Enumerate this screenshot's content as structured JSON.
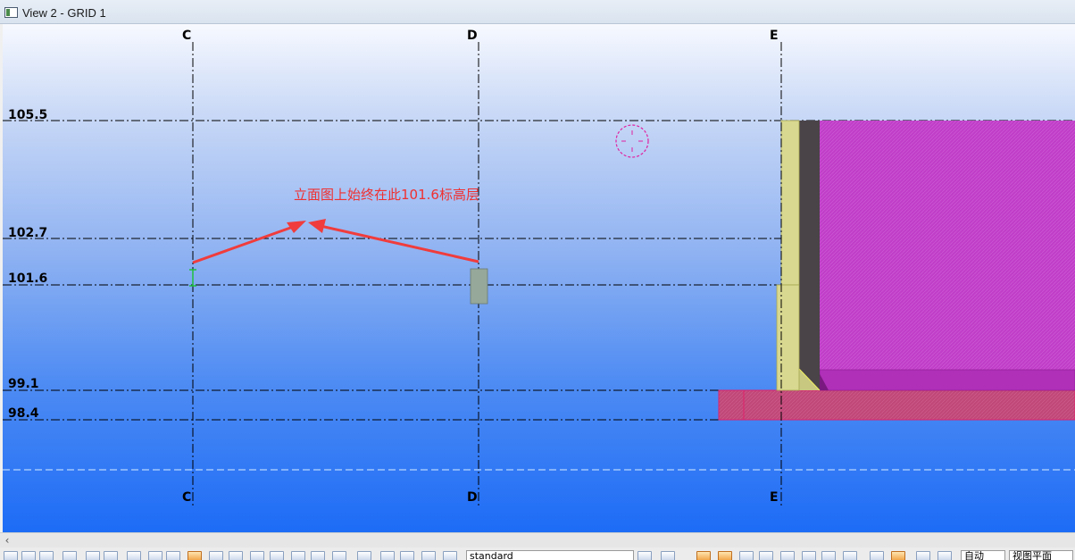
{
  "window": {
    "title": "View 2 - GRID 1"
  },
  "grids": [
    {
      "name": "C",
      "top_label": "C",
      "bottom_label": "C"
    },
    {
      "name": "D",
      "top_label": "D",
      "bottom_label": "D"
    },
    {
      "name": "E",
      "top_label": "E",
      "bottom_label": "E"
    }
  ],
  "levels": [
    {
      "label": "105.5"
    },
    {
      "label": "102.7"
    },
    {
      "label": "101.6"
    },
    {
      "label": "99.1"
    },
    {
      "label": "98.4"
    }
  ],
  "annotation": {
    "text": "立面图上始终在此101.6标高层"
  },
  "toolbar": {
    "filter_select": "standard",
    "mode_select": "自动",
    "plane_select": "视图平面"
  },
  "colors": {
    "annotation": "#f03030",
    "wall_magenta": "#c03ec8",
    "column_yellow": "#d8d890",
    "dark_panel": "#4a4448",
    "slab": "#c04060"
  }
}
